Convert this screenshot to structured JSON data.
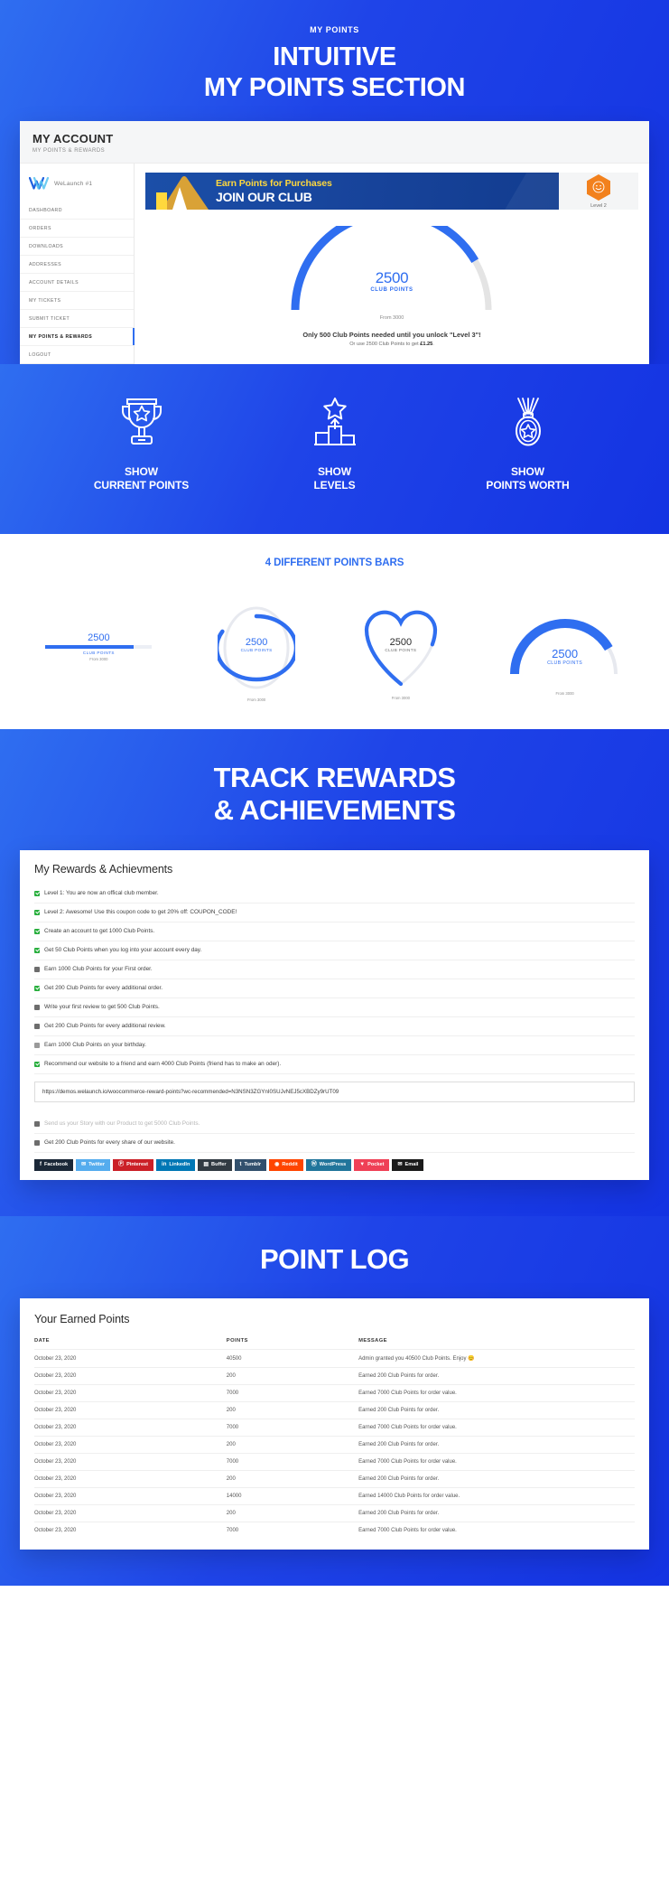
{
  "hero": {
    "kicker": "MY POINTS",
    "title_line1": "INTUITIVE",
    "title_line2": "MY POINTS SECTION"
  },
  "account": {
    "title": "MY ACCOUNT",
    "subtitle": "MY POINTS & REWARDS",
    "brand": "WeLaunch #1",
    "nav": [
      "DASHBOARD",
      "ORDERS",
      "DOWNLOADS",
      "ADDRESSES",
      "ACCOUNT DETAILS",
      "MY TICKETS",
      "SUBMIT TICKET",
      "MY POINTS & REWARDS",
      "LOGOUT"
    ],
    "active_nav": "MY POINTS & REWARDS",
    "promo": {
      "line1": "Earn Points for Purchases",
      "line2": "JOIN OUR CLUB"
    },
    "level_label": "Level 2",
    "gauge": {
      "value": "2500",
      "unit": "CLUB POINTS",
      "from": "From 3000",
      "message": "Only 500 Club Points needed until you unlock \"Level 3\"!",
      "submessage_pre": "Or use 2500 Club Points to get ",
      "submessage_amount": "£1.25",
      "submessage_post": ".",
      "percent": 83
    }
  },
  "features": [
    {
      "icon": "trophy-icon",
      "line1": "SHOW",
      "line2": "CURRENT POINTS"
    },
    {
      "icon": "podium-star-icon",
      "line1": "SHOW",
      "line2": "LEVELS"
    },
    {
      "icon": "medal-icon",
      "line1": "SHOW",
      "line2": "POINTS WORTH"
    }
  ],
  "bars": {
    "title": "4 DIFFERENT POINTS BARS",
    "value": "2500",
    "unit": "CLUB POINTS",
    "from": "From 3000",
    "styles": [
      "linear",
      "circle",
      "heart",
      "gauge"
    ]
  },
  "rewards_section": {
    "title_line1": "TRACK REWARDS",
    "title_line2": "& ACHIEVEMENTS",
    "card_title": "My Rewards & Achievments",
    "items": [
      {
        "state": "done",
        "text": "Level 1: You are now an offical club member."
      },
      {
        "state": "done",
        "text": "Level 2: Awesome! Use this coupon code to get 20% off: COUPON_CODE!"
      },
      {
        "state": "done",
        "text": "Create an account to get 1000 Club Points."
      },
      {
        "state": "done",
        "text": "Get 50 Club Points when you log into your account every day."
      },
      {
        "state": "todo",
        "text": "Earn 1000 Club Points for your First order."
      },
      {
        "state": "done",
        "text": "Get 200 Club Points for every additional order."
      },
      {
        "state": "todo",
        "text": "Write your first review to get 500 Club Points."
      },
      {
        "state": "todo",
        "text": "Get 200 Club Points for every additional review."
      },
      {
        "state": "cake",
        "text": "Earn 1000 Club Points on your birthday."
      },
      {
        "state": "done",
        "text": "Recommend our website to a friend and earn 4000 Club Points (friend has to make an oder)."
      }
    ],
    "referral_url": "https://demos.welaunch.io/woocommerce-reward-points?wc-recommended=N3NSN3ZGYnI0SUJvNEJ5cXBDZy9rUT09",
    "items_after": [
      {
        "state": "muted",
        "text": "Send us your Story with our Product to get 5000 Club Points."
      },
      {
        "state": "todo",
        "text": "Get 200 Club Points for every share of our website."
      }
    ],
    "share_buttons": [
      {
        "label": "Facebook",
        "glyph": "f",
        "color": "#1b2838"
      },
      {
        "label": "Twitter",
        "glyph": "✉",
        "color": "#55acee"
      },
      {
        "label": "Pinterest",
        "glyph": "Ⓟ",
        "color": "#cb2027"
      },
      {
        "label": "LinkedIn",
        "glyph": "in",
        "color": "#0077b5"
      },
      {
        "label": "Buffer",
        "glyph": "▤",
        "color": "#323b43"
      },
      {
        "label": "Tumblr",
        "glyph": "t",
        "color": "#32506d"
      },
      {
        "label": "Reddit",
        "glyph": "◉",
        "color": "#ff4500"
      },
      {
        "label": "WordPress",
        "glyph": "Ⓦ",
        "color": "#21759b"
      },
      {
        "label": "Pocket",
        "glyph": "▼",
        "color": "#ef4056"
      },
      {
        "label": "Email",
        "glyph": "✉",
        "color": "#1b1b1b"
      }
    ]
  },
  "log_section": {
    "title": "POINT LOG",
    "card_title": "Your Earned Points",
    "columns": [
      "DATE",
      "POINTS",
      "MESSAGE"
    ],
    "rows": [
      [
        "October 23, 2020",
        "40500",
        "Admin granted you 40500 Club Points. Enjoy 😊"
      ],
      [
        "October 23, 2020",
        "200",
        "Earned 200 Club Points for order."
      ],
      [
        "October 23, 2020",
        "7000",
        "Earned 7000 Club Points for order value."
      ],
      [
        "October 23, 2020",
        "200",
        "Earned 200 Club Points for order."
      ],
      [
        "October 23, 2020",
        "7000",
        "Earned 7000 Club Points for order value."
      ],
      [
        "October 23, 2020",
        "200",
        "Earned 200 Club Points for order."
      ],
      [
        "October 23, 2020",
        "7000",
        "Earned 7000 Club Points for order value."
      ],
      [
        "October 23, 2020",
        "200",
        "Earned 200 Club Points for order."
      ],
      [
        "October 23, 2020",
        "14000",
        "Earned 14000 Club Points for order value."
      ],
      [
        "October 23, 2020",
        "200",
        "Earned 200 Club Points for order."
      ],
      [
        "October 23, 2020",
        "7000",
        "Earned 7000 Club Points for order value."
      ]
    ]
  },
  "colors": {
    "brand_blue": "#2f6ef0",
    "deep_blue": "#1433e2",
    "orange": "#f2811d",
    "green": "#27ae3c",
    "promo_yellow": "#ffd83d"
  }
}
